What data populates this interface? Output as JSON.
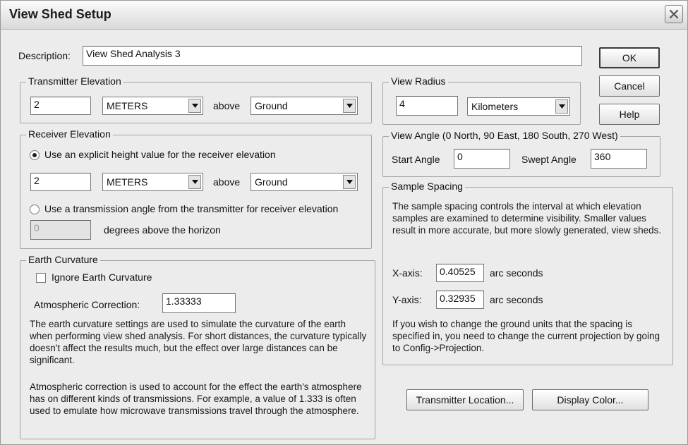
{
  "window": {
    "title": "View Shed Setup"
  },
  "description": {
    "label": "Description:",
    "value": "View Shed Analysis 3"
  },
  "buttons": {
    "ok": "OK",
    "cancel": "Cancel",
    "help": "Help",
    "transmitter_location": "Transmitter Location...",
    "display_color": "Display Color..."
  },
  "transmitter_elevation": {
    "legend": "Transmitter Elevation",
    "value": "2",
    "units": "METERS",
    "above_label": "above",
    "reference": "Ground"
  },
  "receiver_elevation": {
    "legend": "Receiver Elevation",
    "option_explicit": "Use an explicit height value for the receiver elevation",
    "value": "2",
    "units": "METERS",
    "above_label": "above",
    "reference": "Ground",
    "option_angle": "Use a transmission angle from the transmitter for receiver elevation",
    "angle_value": "0",
    "angle_label": "degrees above the horizon",
    "selected_option": "explicit"
  },
  "earth_curvature": {
    "legend": "Earth Curvature",
    "ignore_label": "Ignore Earth Curvature",
    "ignore_checked": false,
    "atmospheric_label": "Atmospheric Correction:",
    "atmospheric_value": "1.33333",
    "para1": "The earth curvature settings are used to simulate the curvature of the earth when performing view shed analysis. For short distances, the curvature typically doesn't affect the results much, but the effect over large distances can be significant.",
    "para2": "Atmospheric correction is used to account for the effect the earth's atmosphere has on different kinds of transmissions. For example, a value of 1.333 is often used to emulate how microwave transmissions travel through the atmosphere."
  },
  "view_radius": {
    "legend": "View Radius",
    "value": "4",
    "units": "Kilometers"
  },
  "view_angle": {
    "legend": "View Angle (0 North, 90 East, 180 South, 270 West)",
    "start_label": "Start Angle",
    "start_value": "0",
    "swept_label": "Swept Angle",
    "swept_value": "360"
  },
  "sample_spacing": {
    "legend": "Sample Spacing",
    "para1": "The sample spacing controls the interval at which elevation samples are examined to determine visibility. Smaller values result in more accurate, but more slowly generated, view sheds.",
    "x_label": "X-axis:",
    "x_value": "0.40525",
    "x_units": "arc seconds",
    "y_label": "Y-axis:",
    "y_value": "0.32935",
    "y_units": "arc seconds",
    "para2": "If you wish to change the ground units that the spacing is specified in, you need to change the current projection by going to Config->Projection."
  }
}
